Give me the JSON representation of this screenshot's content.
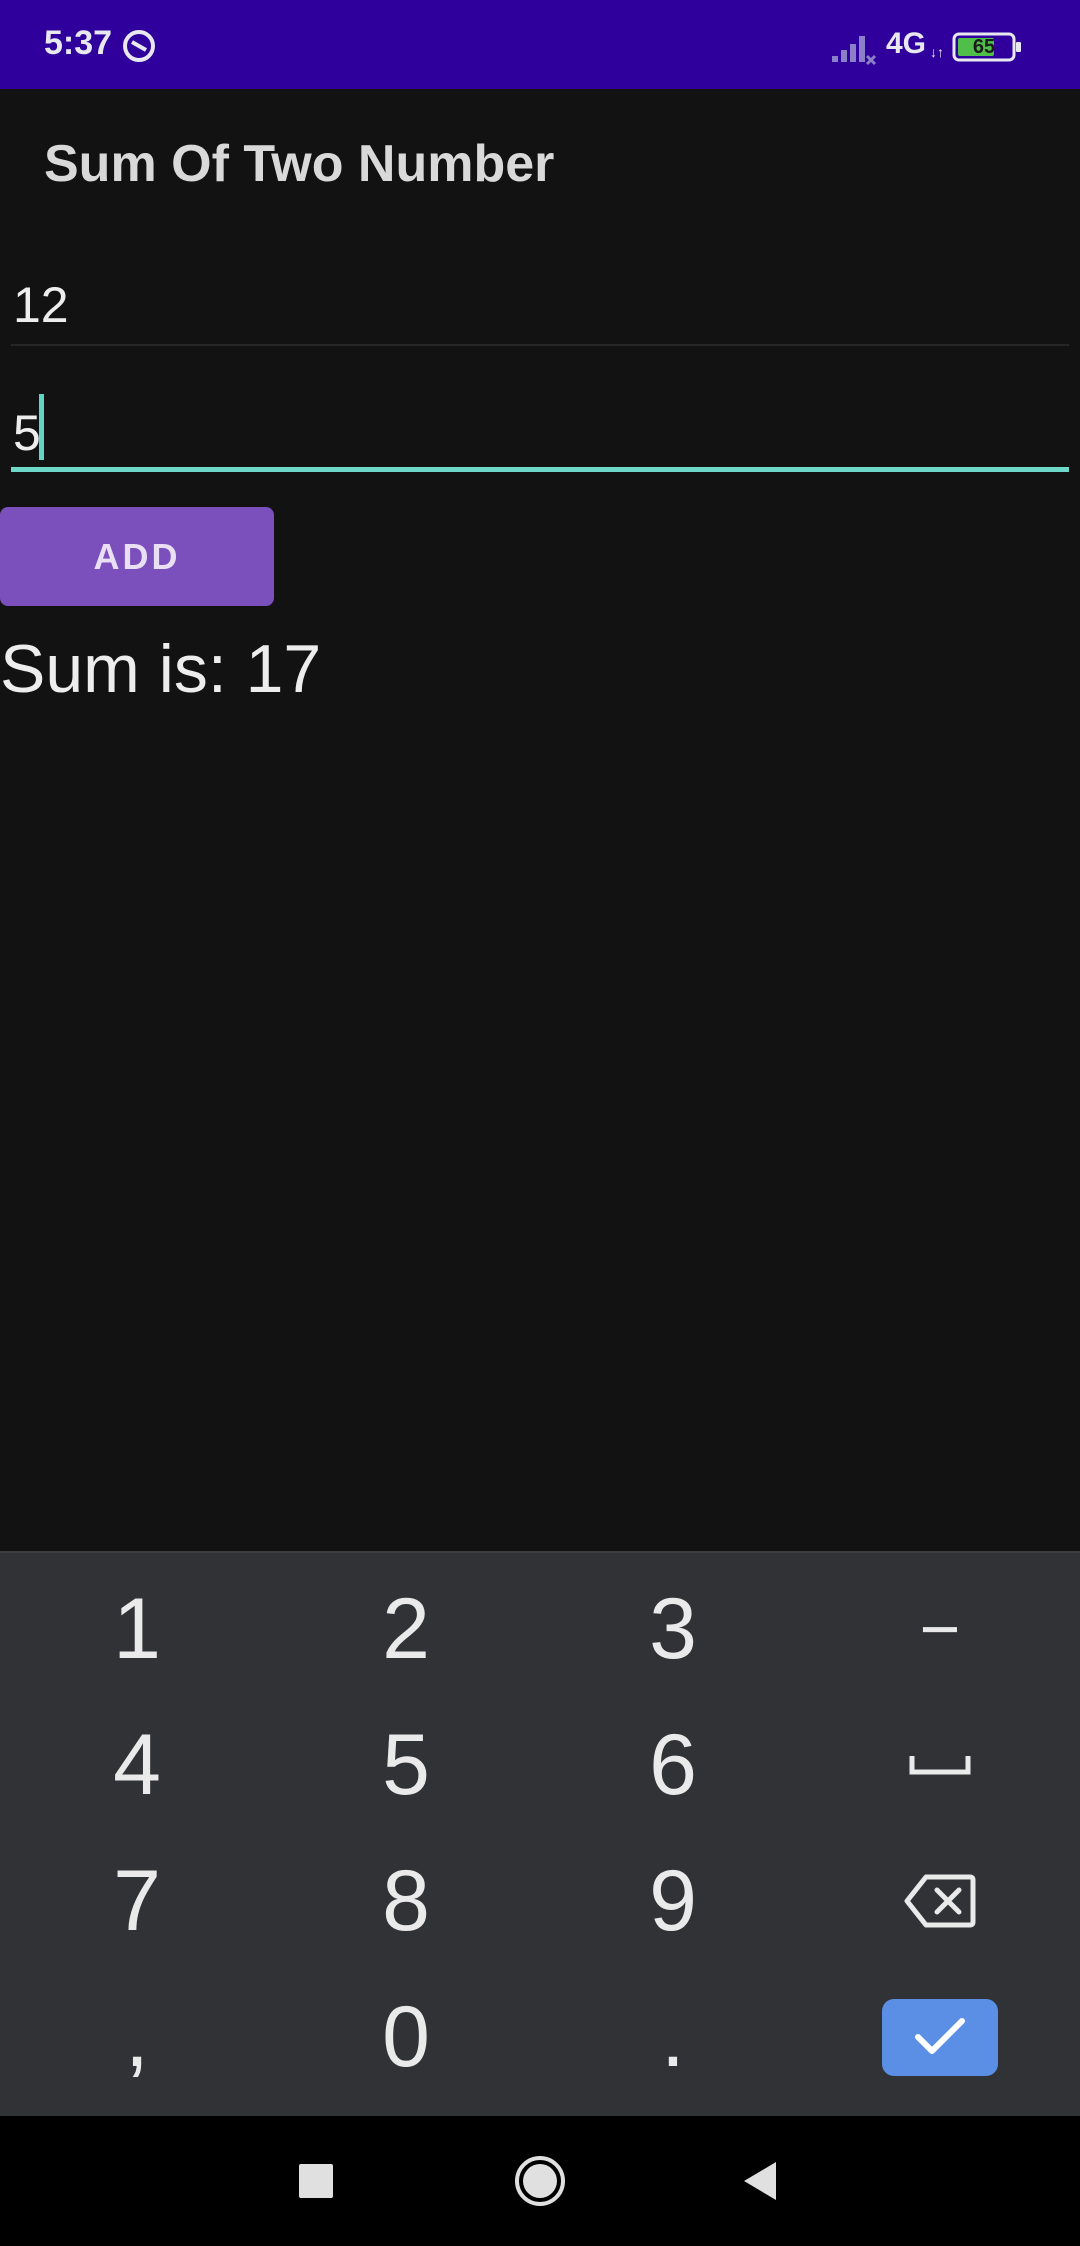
{
  "status_bar": {
    "time": "5:37",
    "network": "4G",
    "network_arrows": "↓↑",
    "battery_level": "65",
    "icons": [
      "do-not-disturb-icon",
      "signal-icon",
      "battery-icon"
    ]
  },
  "app_bar": {
    "title": "Sum Of Two Number"
  },
  "form": {
    "first_number": "12",
    "second_number": "5",
    "add_label": "ADD",
    "result": "Sum is: 17"
  },
  "keyboard": {
    "rows": [
      [
        {
          "label": "1"
        },
        {
          "label": "2"
        },
        {
          "label": "3"
        },
        {
          "label": "−"
        }
      ],
      [
        {
          "label": "4"
        },
        {
          "label": "5"
        },
        {
          "label": "6"
        },
        {
          "label": "space",
          "icon": "space-icon"
        }
      ],
      [
        {
          "label": "7"
        },
        {
          "label": "8"
        },
        {
          "label": "9"
        },
        {
          "label": "backspace",
          "icon": "backspace-icon"
        }
      ],
      [
        {
          "label": ","
        },
        {
          "label": "0"
        },
        {
          "label": "."
        },
        {
          "label": "done",
          "icon": "checkmark-icon"
        }
      ]
    ],
    "done_color": "#5b8fe6"
  },
  "nav_bar": {
    "buttons": [
      "recent-apps-icon",
      "home-icon",
      "back-icon"
    ]
  },
  "colors": {
    "status_bar": "#30009c",
    "background": "#121212",
    "accent": "#6fd9c9",
    "button": "#7b4fbc"
  }
}
